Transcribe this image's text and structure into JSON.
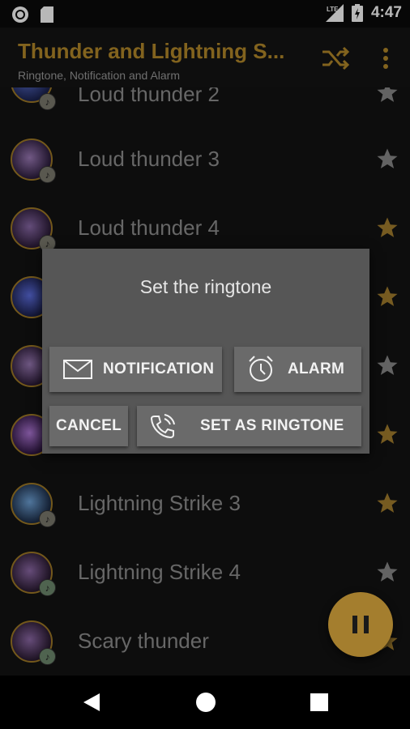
{
  "status_bar": {
    "time": "4:47",
    "network": "LTE"
  },
  "app_bar": {
    "title": "Thunder and Lightning S...",
    "subtitle": "Ringtone, Notification and Alarm",
    "accent_color": "#b58a2a"
  },
  "list": {
    "items": [
      {
        "label": "Loud thunder 2",
        "favorite": false,
        "badge": "♪"
      },
      {
        "label": "Loud thunder 3",
        "favorite": false,
        "badge": "♪"
      },
      {
        "label": "Loud thunder 4",
        "favorite": true,
        "badge": "♪"
      },
      {
        "label": "",
        "favorite": true,
        "badge": ""
      },
      {
        "label": "",
        "favorite": false,
        "badge": ""
      },
      {
        "label": "",
        "favorite": true,
        "badge": ""
      },
      {
        "label": "Lightning Strike 3",
        "favorite": true,
        "badge": "♪"
      },
      {
        "label": "Lightning Strike 4",
        "favorite": false,
        "badge": "♪"
      },
      {
        "label": "Scary thunder",
        "favorite": true,
        "badge": "♪"
      }
    ]
  },
  "dialog": {
    "title": "Set the ringtone",
    "notification_label": "NOTIFICATION",
    "alarm_label": "ALARM",
    "cancel_label": "CANCEL",
    "set_ringtone_label": "SET AS RINGTONE"
  },
  "fab": {
    "icon": "pause-icon"
  },
  "colors": {
    "star_on": "#a47e2e",
    "star_off": "#8a8a8a",
    "fab": "#a47e2e"
  }
}
